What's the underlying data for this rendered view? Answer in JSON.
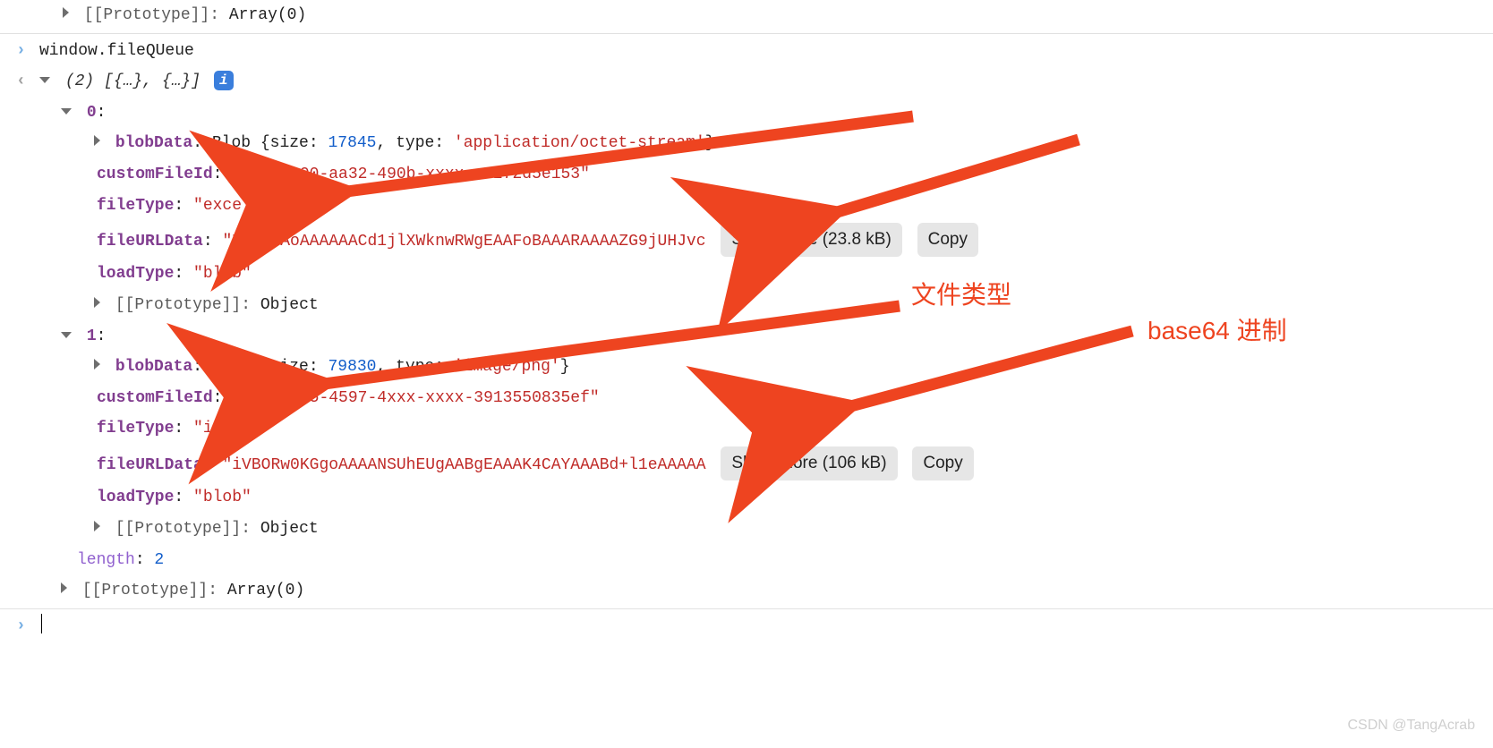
{
  "top": {
    "proto_label": "[[Prototype]]",
    "proto_value": "Array(0)"
  },
  "inputExpr": "window.fileQUeue",
  "resultSummary": "(2) [{…}, {…}]",
  "items": [
    {
      "index": "0",
      "blob_label": "blobData",
      "blob_prefix": "Blob {size: ",
      "blob_size": "17845",
      "blob_mid": ", type: ",
      "blob_type": "'application/octet-stream'",
      "blob_suffix": "}",
      "cfid_label": "customFileId",
      "cfid_value": "\"ccde9900-aa32-490b-xxxx-x8272d5e153\"",
      "ftype_label": "fileType",
      "ftype_value": "\"excel\"",
      "furl_label": "fileURLData",
      "furl_value": "\"UEsDBAoAAAAAACd1jlXWknwRWgEAAFoBAAARAAAAZG9jUHJvc",
      "show_more": "Show more (23.8 kB)",
      "copy": "Copy",
      "ltype_label": "loadType",
      "ltype_value": "\"blob\"",
      "proto_label": "[[Prototype]]",
      "proto_value": "Object"
    },
    {
      "index": "1",
      "blob_label": "blobData",
      "blob_prefix": "Blob {size: ",
      "blob_size": "79830",
      "blob_mid": ", type: ",
      "blob_type": "'image/png'",
      "blob_suffix": "}",
      "cfid_label": "customFileId",
      "cfid_value": "\"5826c475-4597-4xxx-xxxx-3913550835ef\"",
      "ftype_label": "fileType",
      "ftype_value": "\"img\"",
      "furl_label": "fileURLData",
      "furl_value": "\"iVBORw0KGgoAAAANSUhEUgAABgEAAAK4CAYAAABd+l1eAAAAA",
      "show_more": "Show more (106 kB)",
      "copy": "Copy",
      "ltype_label": "loadType",
      "ltype_value": "\"blob\"",
      "proto_label": "[[Prototype]]",
      "proto_value": "Object"
    }
  ],
  "length_label": "length",
  "length_value": "2",
  "outer_proto_label": "[[Prototype]]",
  "outer_proto_value": "Array(0)",
  "annotations": {
    "file_type": "文件类型",
    "base64": "base64 进制"
  },
  "watermark": "CSDN @TangAcrab"
}
